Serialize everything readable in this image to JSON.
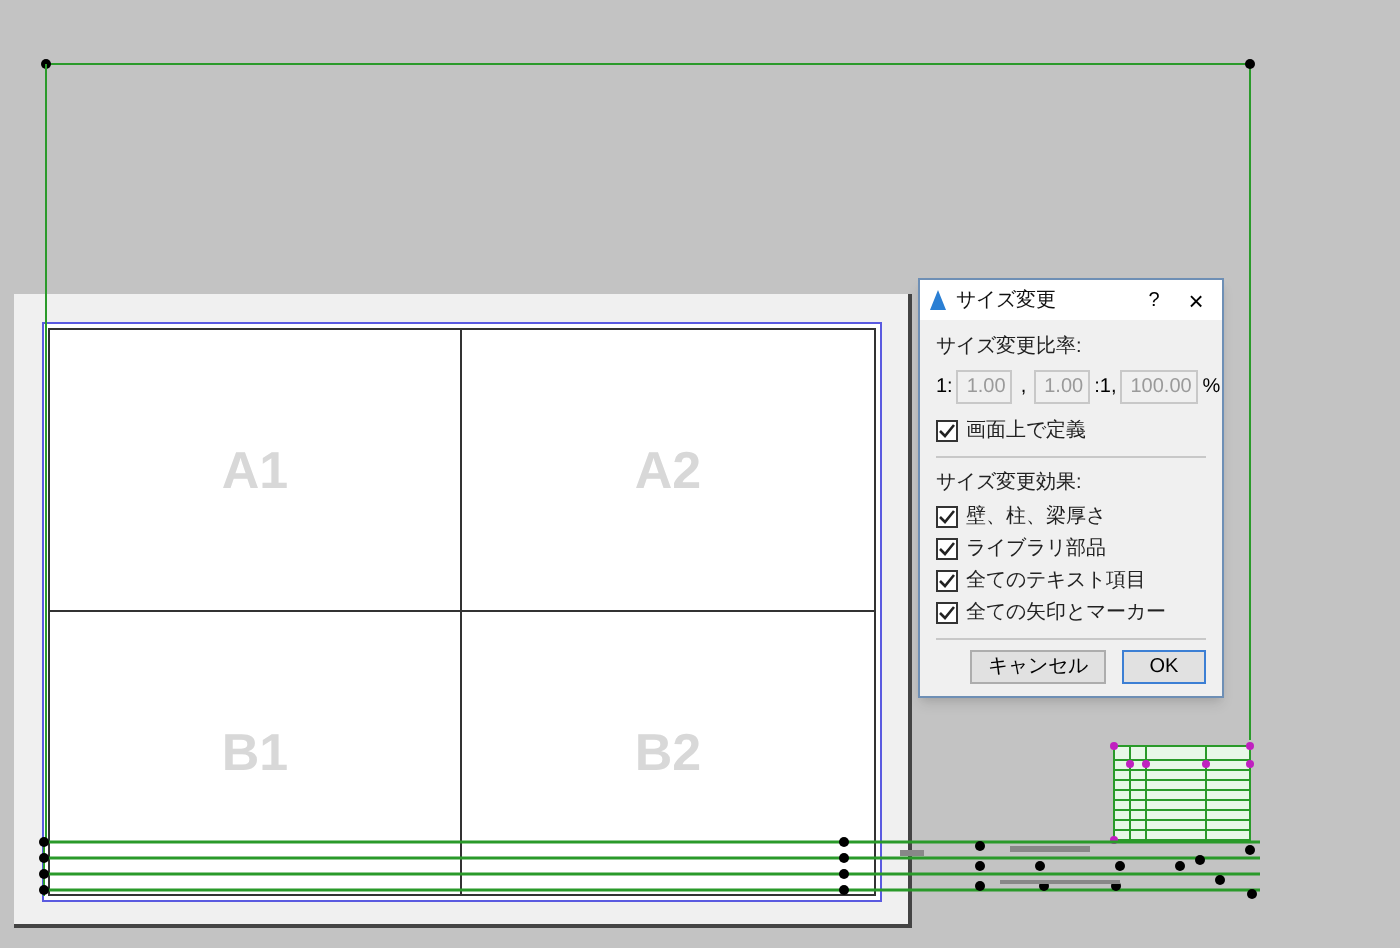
{
  "sheet": {
    "cells": [
      "A1",
      "A2",
      "B1",
      "B2"
    ]
  },
  "dialog": {
    "title": "サイズ変更",
    "help": "?",
    "close": "×",
    "ratio_label": "サイズ変更比率:",
    "ratio": {
      "prefix": "1:",
      "sep1": ",",
      "sep2": ":1,",
      "suffix": "%",
      "fields": [
        {
          "value": "1.00",
          "disabled": true
        },
        {
          "value": "1.00",
          "disabled": true
        },
        {
          "value": "100.00",
          "disabled": true
        }
      ]
    },
    "define_on_screen": {
      "label": "画面上で定義",
      "checked": true
    },
    "effects_label": "サイズ変更効果:",
    "effects": [
      {
        "label": "壁、柱、梁厚さ",
        "checked": true
      },
      {
        "label": "ライブラリ部品",
        "checked": true
      },
      {
        "label": "全てのテキスト項目",
        "checked": true
      },
      {
        "label": "全ての矢印とマーカー",
        "checked": true
      }
    ],
    "buttons": [
      {
        "label": "キャンセル",
        "default": false
      },
      {
        "label": "OK",
        "default": true
      }
    ]
  }
}
